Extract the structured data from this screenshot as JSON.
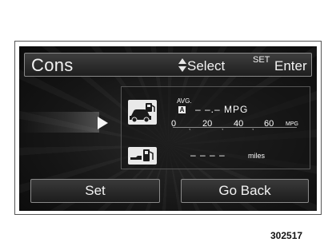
{
  "header": {
    "title": "Cons",
    "select_label": "Select",
    "set_label": "SET",
    "enter_label": "Enter"
  },
  "fuel_economy": {
    "avg_label": "AVG.",
    "mode_badge": "A",
    "value_text": "– –.– MPG",
    "scale_ticks": [
      "0",
      "20",
      "40",
      "60"
    ],
    "scale_unit": "MPG"
  },
  "range": {
    "value_text": "– – – –",
    "unit": "miles"
  },
  "buttons": {
    "set_label": "Set",
    "back_label": "Go Back"
  },
  "figure_id": "302517",
  "icons": [
    "updown-icon",
    "play-arrow-icon",
    "car-fuel-icon",
    "fuel-pump-icon"
  ]
}
